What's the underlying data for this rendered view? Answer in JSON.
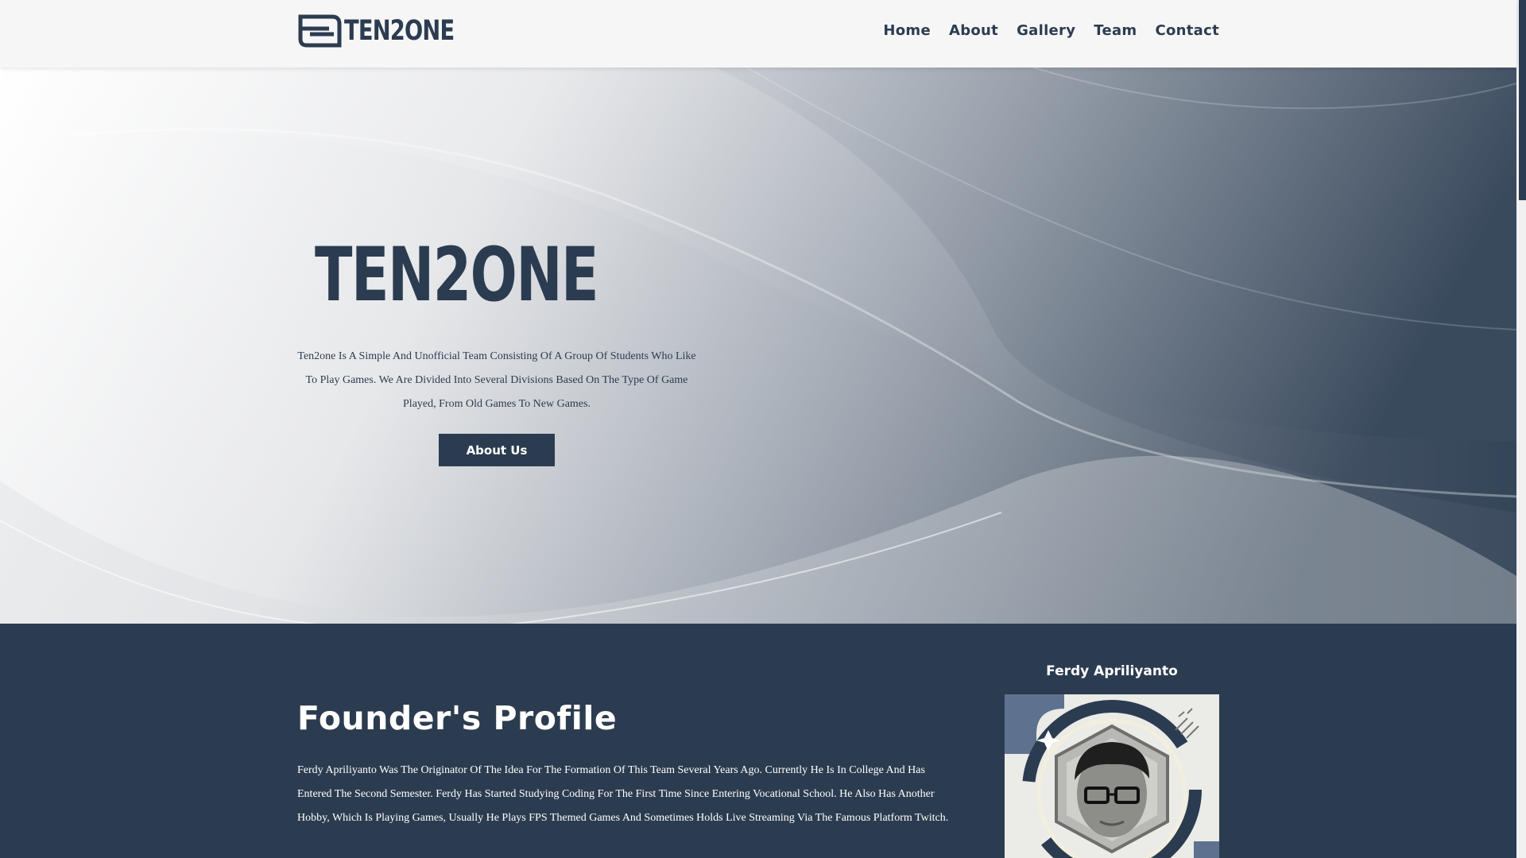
{
  "header": {
    "brand": "TEN2ONE",
    "nav": [
      "Home",
      "About",
      "Gallery",
      "Team",
      "Contact"
    ]
  },
  "hero": {
    "brand": "TEN2ONE",
    "description": "Ten2one Is A Simple And Unofficial Team Consisting Of A Group Of Students Who Like To Play Games. We Are Divided Into Several Divisions Based On The Type Of Game Played, From Old Games To New Games.",
    "button_label": "About Us"
  },
  "founder": {
    "title": "Founder's Profile",
    "bio": "Ferdy Apriliyanto Was The Originator Of The Idea For The Formation Of This Team Several Years Ago. Currently He Is In College And Has Entered The Second Semester. Ferdy Has Started Studying Coding For The First Time Since Entering Vocational School. He Also Has Another Hobby, Which Is Playing Games, Usually He Plays FPS Themed Games And Sometimes Holds Live Streaming Via The Famous Platform Twitch.",
    "name": "Ferdy Apriliyanto"
  },
  "colors": {
    "primary": "#2c3c50",
    "header_bg": "#f6f6f6",
    "text_light": "#ffffff"
  },
  "icons": {
    "brand_logo": "controller-logo-mark",
    "scroll": "scrollbar"
  }
}
